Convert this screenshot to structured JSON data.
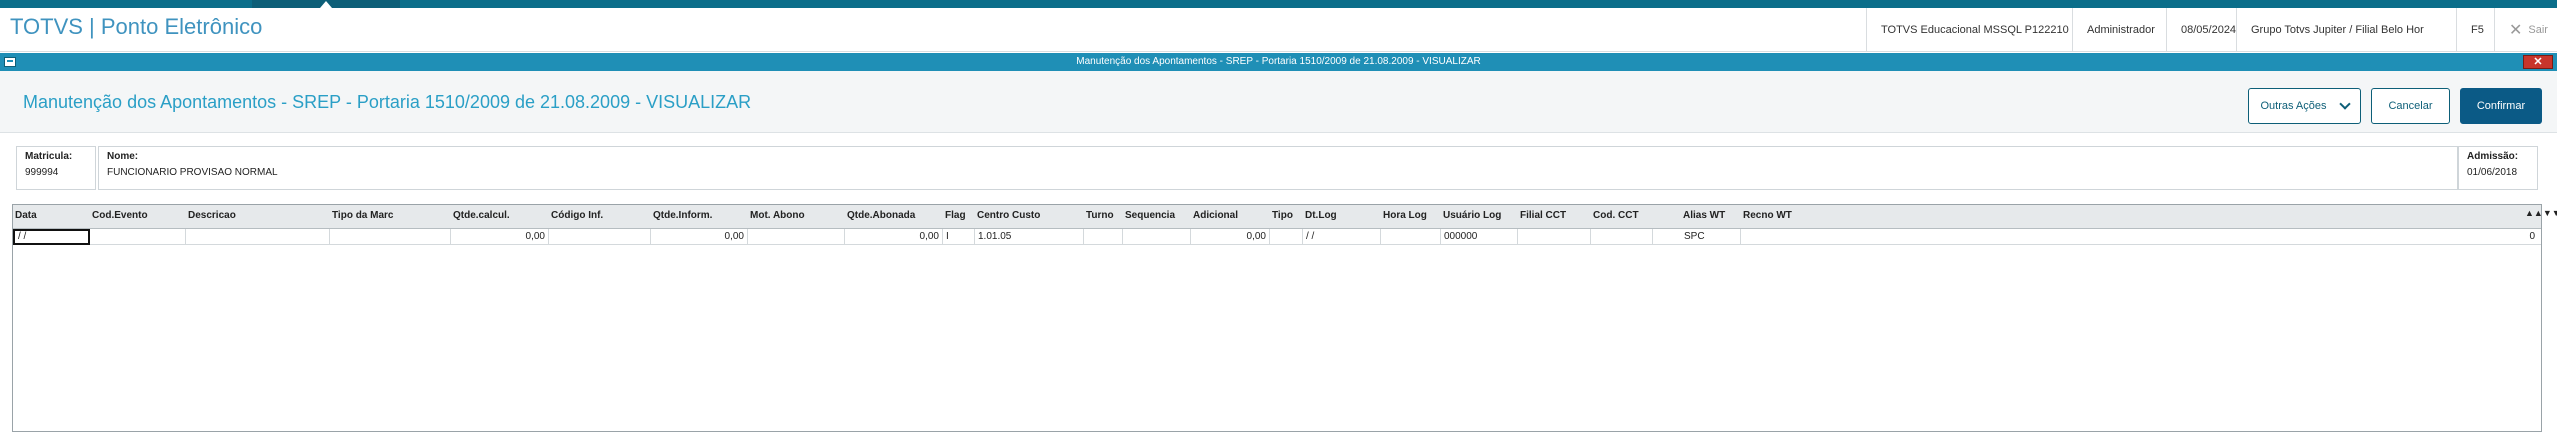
{
  "header": {
    "app_title": "TOTVS | Ponto Eletrônico",
    "environment": "TOTVS Educacional MSSQL P122210",
    "user": "Administrador",
    "date": "08/05/2024",
    "company": "Grupo Totvs Jupiter / Filial Belo Hor",
    "f5": "F5",
    "exit_label": "Sair"
  },
  "dialog": {
    "window_title": "Manutenção dos Apontamentos - SREP - Portaria 1510/2009 de 21.08.2009 - VISUALIZAR",
    "heading": "Manutenção dos Apontamentos - SREP - Portaria 1510/2009 de 21.08.2009 - VISUALIZAR",
    "buttons": {
      "other_actions": "Outras Ações",
      "cancel": "Cancelar",
      "confirm": "Confirmar"
    }
  },
  "employee": {
    "matricula_label": "Matricula:",
    "matricula_value": "999994",
    "nome_label": "Nome:",
    "nome_value": "FUNCIONARIO PROVISAO NORMAL",
    "admissao_label": "Admissão:",
    "admissao_value": "01/06/2018"
  },
  "grid": {
    "columns": [
      "Data",
      "Cod.Evento",
      "Descricao",
      "Tipo da Marc",
      "Qtde.calcul.",
      "Código Inf.",
      "Qtde.Inform.",
      "Mot. Abono",
      "Qtde.Abonada",
      "Flag",
      "Centro Custo",
      "Turno",
      "Sequencia",
      "Adicional",
      "Tipo",
      "Dt.Log",
      "Hora Log",
      "Usuário Log",
      "Filial CCT",
      "Cod. CCT",
      "Alias WT",
      "Recno WT"
    ],
    "rows": [
      [
        "/ /",
        "",
        "",
        "",
        "0,00",
        "",
        "0,00",
        "",
        "0,00",
        "I",
        "1.01.05",
        "",
        "",
        "0,00",
        "",
        "/ /",
        "",
        "000000",
        "",
        "",
        "SPC",
        "0"
      ]
    ],
    "scroll_control": "▲▲▼▼"
  }
}
